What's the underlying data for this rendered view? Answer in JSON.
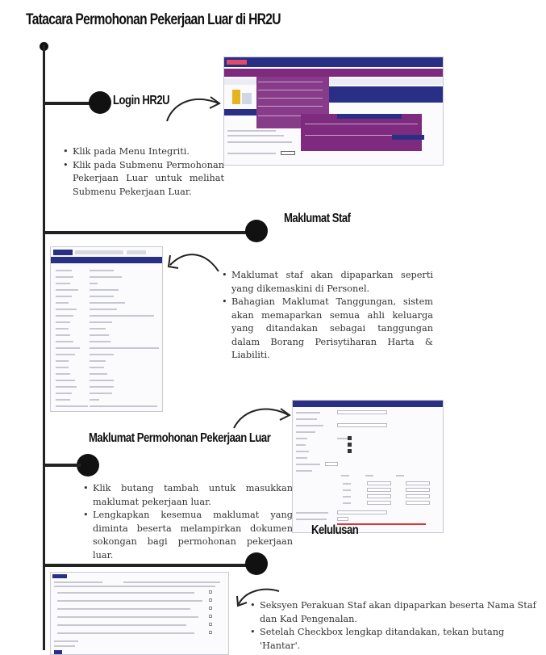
{
  "title": "Tatacara Permohonan Pekerjaan Luar di HR2U",
  "sections": [
    {
      "heading": "Login HR2U",
      "bullets": [
        "Klik pada Menu Integriti.",
        "Klik pada Submenu Permohonan Pekerjaan Luar untuk melihat Submenu Pekerjaan Luar."
      ]
    },
    {
      "heading": "Maklumat Staf",
      "bullets": [
        "Maklumat staf akan dipaparkan seperti yang dikemaskini di Personel.",
        "Bahagian Maklumat Tanggungan, sistem akan memaparkan semua ahli keluarga yang ditandakan sebagai tanggungan dalam Borang Perisytiharan Harta & Liabiliti."
      ]
    },
    {
      "heading": "Maklumat Permohonan Pekerjaan Luar",
      "bullets": [
        "Klik butang tambah untuk masukkan maklumat pekerjaan luar.",
        "Lengkapkan kesemua maklumat yang diminta beserta melampirkan dokumen sokongan bagi permohonan pekerjaan luar."
      ]
    },
    {
      "heading": "Kelulusan",
      "bullets": [
        "Seksyen Perakuan Staf akan dipaparkan beserta Nama Staf dan Kad Pengenalan.",
        "Setelah Checkbox lengkap ditandakan, tekan butang 'Hantar'."
      ]
    }
  ],
  "colors": {
    "navy": "#2a2f86",
    "purple": "#7d2a7f",
    "line": "#222222"
  }
}
